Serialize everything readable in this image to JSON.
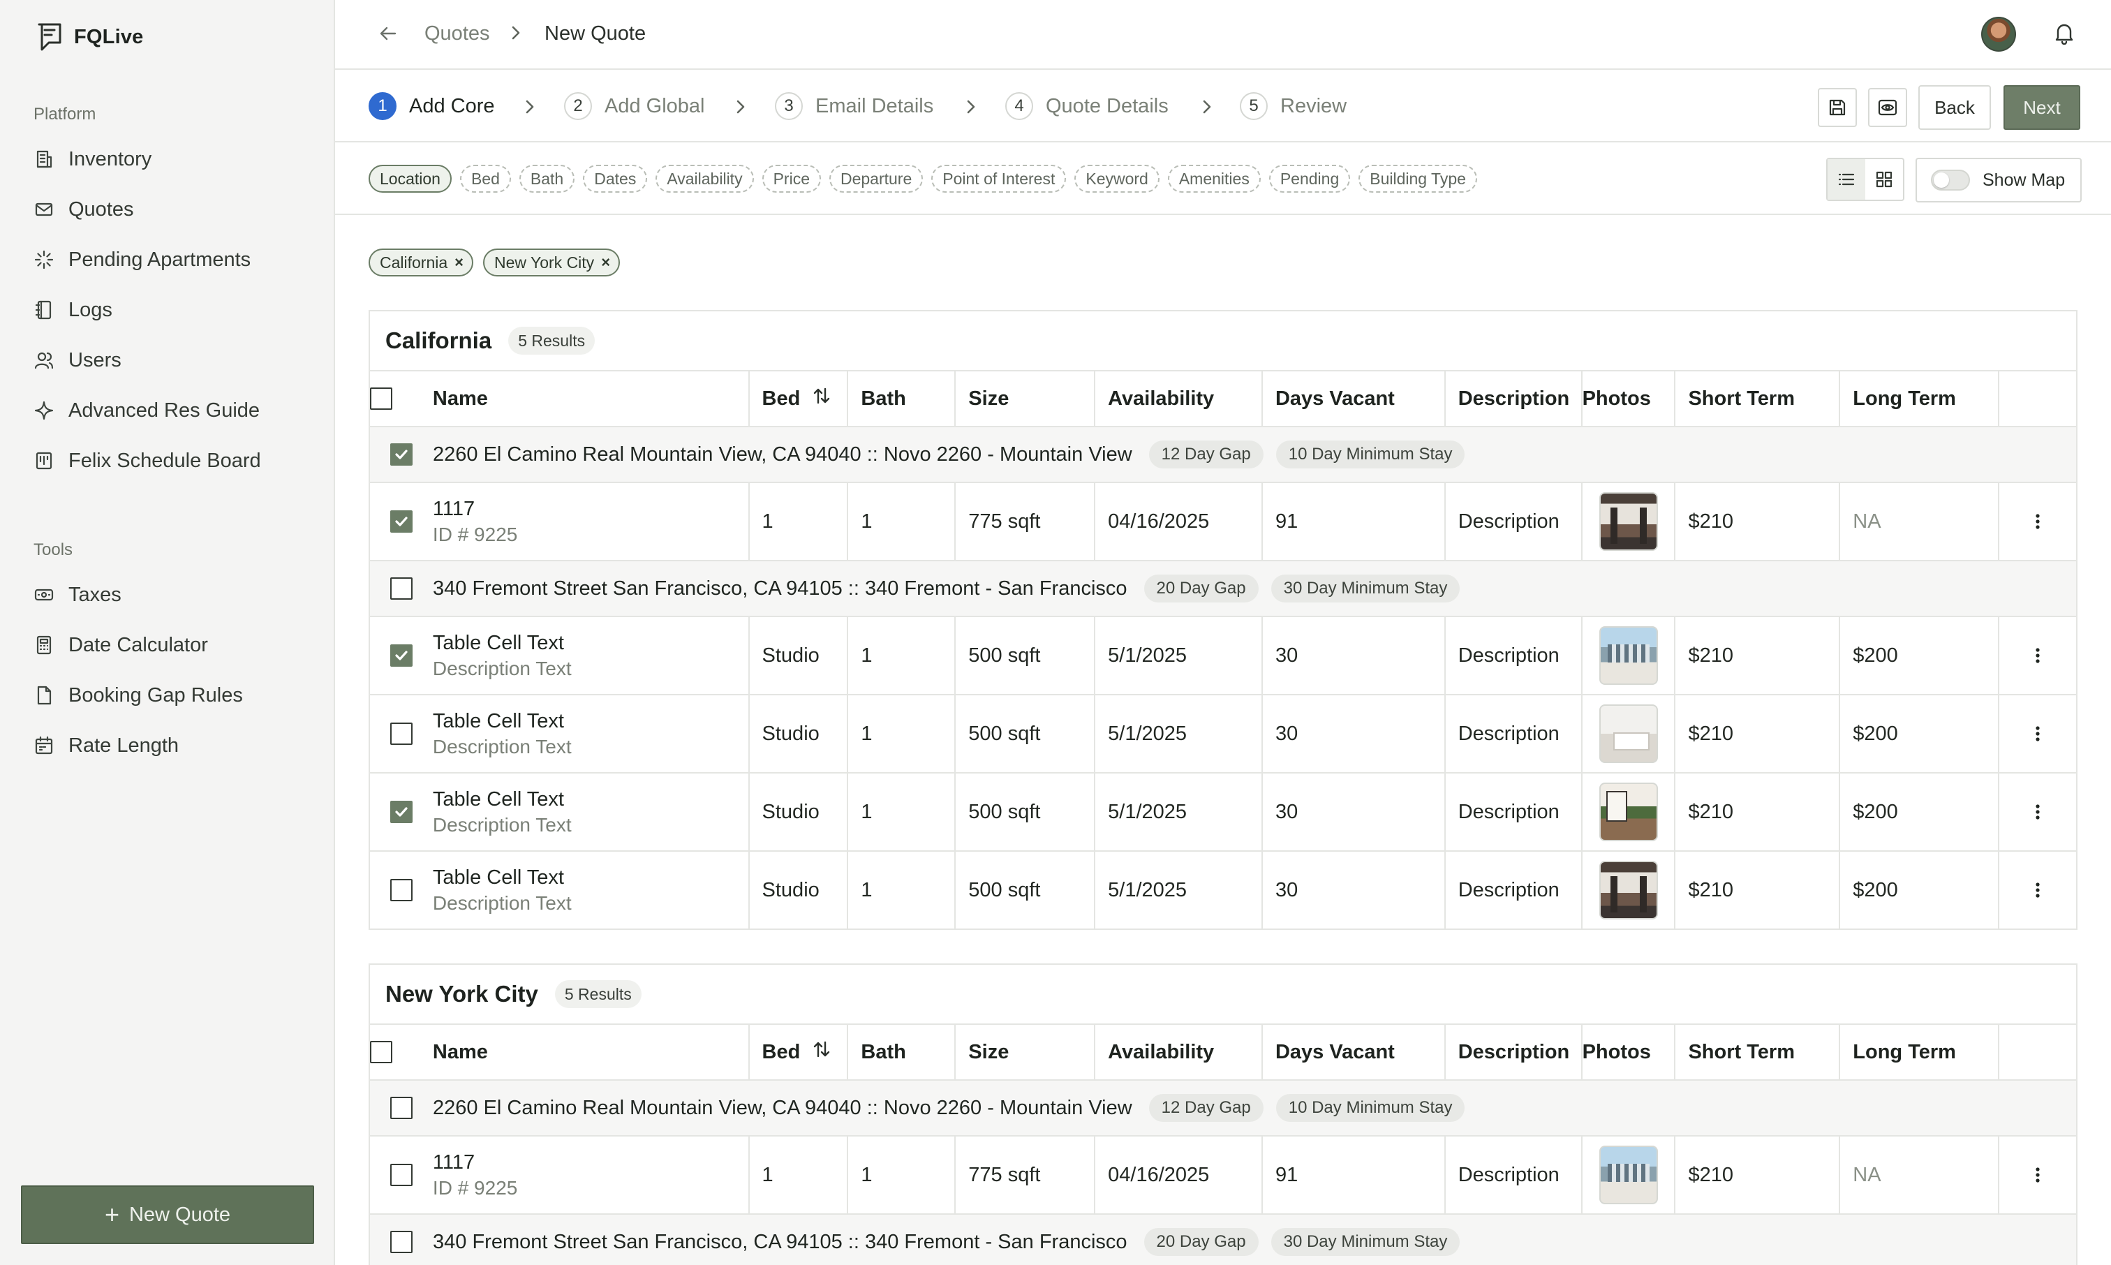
{
  "app": {
    "name": "FQLive"
  },
  "sidebar": {
    "sections": [
      {
        "title": "Platform",
        "items": [
          {
            "label": "Inventory",
            "icon": "building-icon"
          },
          {
            "label": "Quotes",
            "icon": "mail-icon"
          },
          {
            "label": "Pending Apartments",
            "icon": "loader-icon"
          },
          {
            "label": "Logs",
            "icon": "notebook-icon"
          },
          {
            "label": "Users",
            "icon": "users-icon"
          },
          {
            "label": "Advanced Res Guide",
            "icon": "sparkle-icon"
          },
          {
            "label": "Felix Schedule Board",
            "icon": "board-icon"
          }
        ]
      },
      {
        "title": "Tools",
        "items": [
          {
            "label": "Taxes",
            "icon": "money-icon"
          },
          {
            "label": "Date Calculator",
            "icon": "calculator-icon"
          },
          {
            "label": "Booking Gap Rules",
            "icon": "file-icon"
          },
          {
            "label": "Rate Length",
            "icon": "calendar-icon"
          }
        ]
      }
    ],
    "new_quote_label": "New Quote"
  },
  "header": {
    "breadcrumb": [
      "Quotes",
      "New Quote"
    ]
  },
  "stepper": {
    "steps": [
      {
        "num": "1",
        "label": "Add Core",
        "active": true
      },
      {
        "num": "2",
        "label": "Add Global"
      },
      {
        "num": "3",
        "label": "Email Details"
      },
      {
        "num": "4",
        "label": "Quote Details"
      },
      {
        "num": "5",
        "label": "Review"
      }
    ],
    "back_label": "Back",
    "next_label": "Next"
  },
  "filters": {
    "chips": [
      "Location",
      "Bed",
      "Bath",
      "Dates",
      "Availability",
      "Price",
      "Departure",
      "Point of Interest",
      "Keyword",
      "Amenities",
      "Pending",
      "Building Type"
    ],
    "active_chip": "Location",
    "show_map_label": "Show Map",
    "applied": [
      "California",
      "New York City"
    ]
  },
  "table_headers": [
    "Name",
    "Bed",
    "Bath",
    "Size",
    "Availability",
    "Days Vacant",
    "Description",
    "Photos",
    "Short Term",
    "Long Term"
  ],
  "groups": [
    {
      "title": "California",
      "count": "5 Results",
      "rows": [
        {
          "type": "group",
          "checked": true,
          "text": "2260 El Camino Real Mountain View, CA 94040 :: Novo 2260 - Mountain View",
          "badges": [
            "12 Day Gap",
            "10 Day Minimum Stay"
          ]
        },
        {
          "type": "unit",
          "checked": true,
          "name": "1117",
          "sub": "ID # 9225",
          "bed": "1",
          "bath": "1",
          "size": "775 sqft",
          "availability": "04/16/2025",
          "days_vacant": "91",
          "description": "Description",
          "photo": "a",
          "short_term": "$210",
          "long_term": "NA"
        },
        {
          "type": "group",
          "checked": false,
          "text": "340 Fremont Street San Francisco, CA 94105 :: 340 Fremont - San Francisco",
          "badges": [
            "20 Day Gap",
            "30 Day Minimum Stay"
          ]
        },
        {
          "type": "unit",
          "checked": true,
          "name": "Table Cell Text",
          "sub": "Description Text",
          "bed": "Studio",
          "bath": "1",
          "size": "500 sqft",
          "availability": "5/1/2025",
          "days_vacant": "30",
          "description": "Description",
          "photo": "b",
          "short_term": "$210",
          "long_term": "$200"
        },
        {
          "type": "unit",
          "checked": false,
          "name": "Table Cell Text",
          "sub": "Description Text",
          "bed": "Studio",
          "bath": "1",
          "size": "500 sqft",
          "availability": "5/1/2025",
          "days_vacant": "30",
          "description": "Description",
          "photo": "c",
          "short_term": "$210",
          "long_term": "$200"
        },
        {
          "type": "unit",
          "checked": true,
          "name": "Table Cell Text",
          "sub": "Description Text",
          "bed": "Studio",
          "bath": "1",
          "size": "500 sqft",
          "availability": "5/1/2025",
          "days_vacant": "30",
          "description": "Description",
          "photo": "d",
          "short_term": "$210",
          "long_term": "$200"
        },
        {
          "type": "unit",
          "checked": false,
          "name": "Table Cell Text",
          "sub": "Description Text",
          "bed": "Studio",
          "bath": "1",
          "size": "500 sqft",
          "availability": "5/1/2025",
          "days_vacant": "30",
          "description": "Description",
          "photo": "a",
          "short_term": "$210",
          "long_term": "$200"
        }
      ]
    },
    {
      "title": "New York City",
      "count": "5 Results",
      "rows": [
        {
          "type": "group",
          "checked": false,
          "text": "2260 El Camino Real Mountain View, CA 94040 :: Novo 2260 - Mountain View",
          "badges": [
            "12 Day Gap",
            "10 Day Minimum Stay"
          ]
        },
        {
          "type": "unit",
          "checked": false,
          "name": "1117",
          "sub": "ID # 9225",
          "bed": "1",
          "bath": "1",
          "size": "775 sqft",
          "availability": "04/16/2025",
          "days_vacant": "91",
          "description": "Description",
          "photo": "b",
          "short_term": "$210",
          "long_term": "NA"
        },
        {
          "type": "group",
          "checked": false,
          "text": "340 Fremont Street San Francisco, CA 94105 :: 340 Fremont - San Francisco",
          "badges": [
            "20 Day Gap",
            "30 Day Minimum Stay"
          ]
        }
      ]
    }
  ],
  "colors": {
    "accent": "#6b7d66",
    "primary_step": "#2f6ad0",
    "sidebar_bg": "#f4f4f3"
  }
}
